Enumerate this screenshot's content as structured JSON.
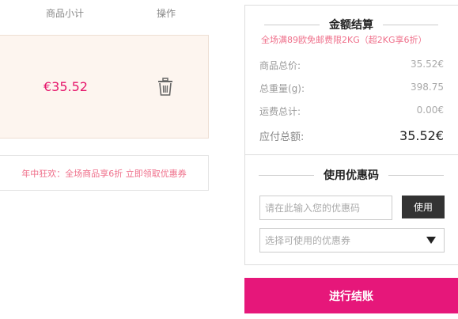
{
  "cart": {
    "col_subtotal_label": "商品小计",
    "col_ops_label": "操作",
    "row_subtotal": "€35.52",
    "delete_icon": "trash-icon",
    "promo_banner": "年中狂欢：全场商品享6折 立即领取优惠券"
  },
  "summary": {
    "title": "金额结算",
    "shipping_note": "全场满89欧免邮费限2KG（超2KG享6折）",
    "rows": {
      "goods_total_label": "商品总价:",
      "goods_total_value": "35.52€",
      "weight_label": "总重量(g):",
      "weight_value": "398.75",
      "shipping_label": "运费总计:",
      "shipping_value": "0.00€",
      "payable_label": "应付总额:",
      "payable_value": "35.52€"
    }
  },
  "coupon": {
    "title": "使用优惠码",
    "input_placeholder": "请在此输入您的优惠码",
    "use_button": "使用",
    "select_placeholder": "选择可使用的优惠券"
  },
  "checkout": {
    "button_label": "进行结账"
  },
  "colors": {
    "accent": "#e6177a",
    "price": "#e6176c",
    "promo_text": "#ef6f8a",
    "row_bg": "#fdf5ef"
  }
}
